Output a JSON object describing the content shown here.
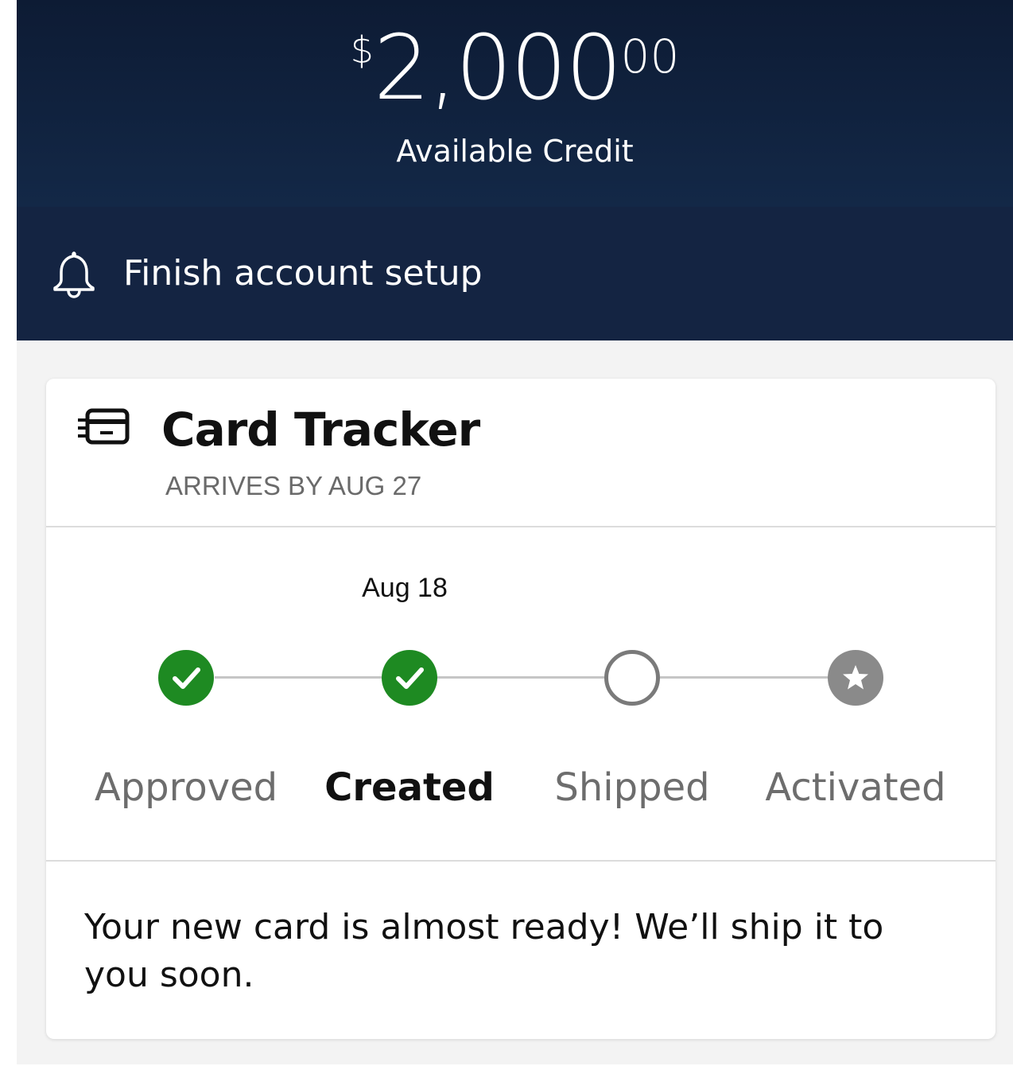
{
  "header": {
    "currency_symbol": "$",
    "balance_whole": "2,000",
    "balance_cents": "00",
    "balance_label": "Available Credit"
  },
  "notification": {
    "icon": "bell-icon",
    "text": "Finish account setup"
  },
  "card_tracker": {
    "icon": "credit-card-icon",
    "title": "Card Tracker",
    "subtitle": "ARRIVES BY AUG 27",
    "steps": [
      {
        "label": "Approved",
        "date": "",
        "status": "complete",
        "icon": "check-icon"
      },
      {
        "label": "Created",
        "date": "Aug 18",
        "status": "complete",
        "icon": "check-icon",
        "current": true
      },
      {
        "label": "Shipped",
        "date": "",
        "status": "pending",
        "icon": "empty-circle-icon"
      },
      {
        "label": "Activated",
        "date": "",
        "status": "locked",
        "icon": "star-icon"
      }
    ],
    "message": "Your new card is almost ready! We’ll ship it to you soon."
  },
  "colors": {
    "header_bg": "#0d1b34",
    "setup_bar_bg": "#142442",
    "complete_green": "#1e8a22",
    "page_bg": "#f3f3f3"
  }
}
